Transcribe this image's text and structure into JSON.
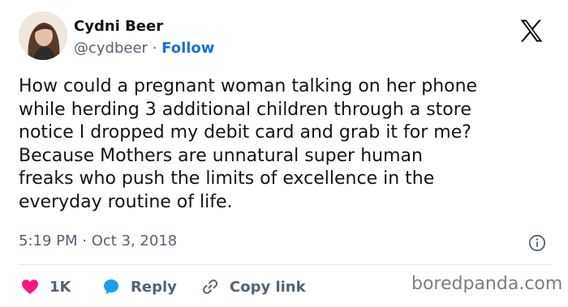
{
  "author": {
    "name": "Cydni Beer",
    "handle": "@cydbeer",
    "separator": "·",
    "follow_label": "Follow"
  },
  "tweet": {
    "lines": [
      "How could a pregnant woman talking on her phone",
      "while herding 3 additional children through a store",
      "notice I dropped my debit card and grab it for me?",
      "Because Mothers are unnatural super human",
      "freaks who push the limits of excellence in the",
      "everyday routine of life."
    ],
    "timestamp": "5:19 PM · Oct 3, 2018"
  },
  "actions": {
    "likes_label": "1K",
    "reply_label": "Reply",
    "copy_label": "Copy link"
  },
  "watermark": "boredpanda.com",
  "icons": {
    "logo": "x-logo-icon",
    "info": "info-icon",
    "like": "heart-icon",
    "reply": "reply-bubble-icon",
    "copy": "link-icon"
  },
  "colors": {
    "follow": "#1d6ed8",
    "heart": "#f91880",
    "reply_bubble": "#1d9bf0",
    "muted": "#536471",
    "divider": "#e4e8ec"
  }
}
